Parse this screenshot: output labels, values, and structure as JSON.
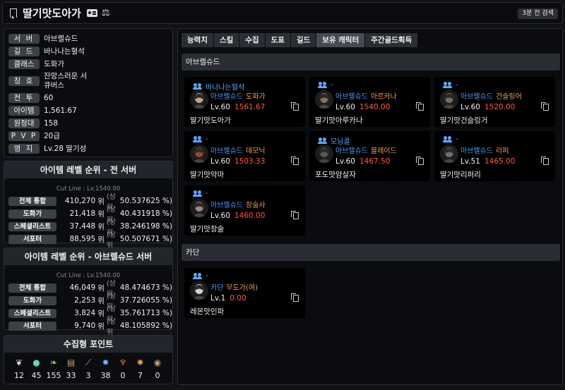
{
  "header": {
    "title": "딸기맛도아가",
    "scale_glyph": "⚖",
    "search_label": "3분 전 검색"
  },
  "info": [
    {
      "label": "서 버",
      "value": "아브렐슈드"
    },
    {
      "label": "길 드",
      "value": "바나나는혈석"
    },
    {
      "label": "클래스",
      "value": "도화가"
    },
    {
      "label": "칭 호",
      "value": "잔망스러운 서큐버스"
    },
    {
      "label": "전 투",
      "value": "60"
    },
    {
      "label": "아이템",
      "value": "1,561.67"
    },
    {
      "label": "원정대",
      "value": "158"
    },
    {
      "label": "P V P",
      "value": "20급"
    },
    {
      "label": "영 지",
      "value": "Lv.28 딸기성"
    }
  ],
  "rank_all": {
    "title": "아이템 레벨 순위 - 전 서버",
    "cutline": "Cut Line : Lv.1540.00",
    "rows": [
      {
        "label": "전체 통합",
        "rank": "410,270",
        "pct": "50.537625 %)"
      },
      {
        "label": "도화가",
        "rank": "21,418",
        "pct": "40.431918 %)"
      },
      {
        "label": "스페셜리스트",
        "rank": "37,448",
        "pct": "38.246198 %)"
      },
      {
        "label": "서포터",
        "rank": "88,595",
        "pct": "50.507671 %)"
      }
    ]
  },
  "rank_server": {
    "title": "아이템 레벨 순위 - 아브렐슈드 서버",
    "cutline": "Cut Line : Lv.1540.00",
    "rows": [
      {
        "label": "전체 통합",
        "rank": "46,049",
        "pct": "48.474673 %)"
      },
      {
        "label": "도화가",
        "rank": "2,253",
        "pct": "37.726055 %)"
      },
      {
        "label": "스페셜리스트",
        "rank": "3,824",
        "pct": "35.761713 %)"
      },
      {
        "label": "서포터",
        "rank": "9,740",
        "pct": "48.105892 %)"
      }
    ]
  },
  "rank_words": {
    "wi": "위",
    "sang": "(상위"
  },
  "collect": {
    "title": "수집형 포인트",
    "items": [
      {
        "icon": "mokoko-seed-icon",
        "glyph": "❦",
        "color": "#d8d8d8",
        "count": "12"
      },
      {
        "icon": "island-heart-icon",
        "glyph": "●",
        "color": "#5cd6c0",
        "count": "45"
      },
      {
        "icon": "sprout-icon",
        "glyph": "❧",
        "color": "#9ad14a",
        "count": "155"
      },
      {
        "icon": "masterpiece-icon",
        "glyph": "▤",
        "color": "#c9a46a",
        "count": "33"
      },
      {
        "icon": "voyage-icon",
        "glyph": "⟋",
        "color": "#e0b050",
        "count": "3"
      },
      {
        "icon": "giant-heart-icon",
        "glyph": "✸",
        "color": "#6fb3ff",
        "count": "38"
      },
      {
        "icon": "ignea-icon",
        "glyph": "♆",
        "color": "#c07040",
        "count": "0"
      },
      {
        "icon": "world-tree-leaf-icon",
        "glyph": "✹",
        "color": "#e0a040",
        "count": "7"
      },
      {
        "icon": "orpheus-star-icon",
        "glyph": "◉",
        "color": "#c8a070",
        "count": "0"
      }
    ]
  },
  "tabs": [
    "능력치",
    "스킬",
    "수집",
    "도표",
    "길드",
    "보유 캐릭터",
    "주간골드획득"
  ],
  "active_tab": 5,
  "servers": [
    {
      "name": "아브렐슈드",
      "chars": [
        {
          "guild": "바나나는혈석",
          "server": "아브렐슈드",
          "class": "도화가",
          "lv": "Lv.60",
          "ilvl": "1561.67",
          "name": "딸기맛도아가",
          "avatar": "#c8a38a"
        },
        {
          "guild": "-",
          "server": "아브렐슈드",
          "class": "아르카나",
          "lv": "Lv.60",
          "ilvl": "1540.00",
          "name": "딸기맛아루카나",
          "avatar": "#8a7060"
        },
        {
          "guild": "-",
          "server": "아브렐슈드",
          "class": "건슬링어",
          "lv": "Lv.60",
          "ilvl": "1520.00",
          "name": "딸기맛건슬링거",
          "avatar": "#7a6a60"
        },
        {
          "guild": "-",
          "server": "아브렐슈드",
          "class": "데모닉",
          "lv": "Lv.60",
          "ilvl": "1503.33",
          "name": "딸기맛악마",
          "avatar": "#a04030"
        },
        {
          "guild": "모닝콜",
          "server": "아브렐슈드",
          "class": "블레이드",
          "lv": "Lv.60",
          "ilvl": "1467.50",
          "name": "포도맛암살자",
          "avatar": "#605850"
        },
        {
          "guild": "-",
          "server": "아브렐슈드",
          "class": "리퍼",
          "lv": "Lv.51",
          "ilvl": "1465.00",
          "name": "딸기맛리퍼리",
          "avatar": "#707070"
        },
        {
          "guild": "-",
          "server": "아브렐슈드",
          "class": "창술사",
          "lv": "Lv.60",
          "ilvl": "1460.00",
          "name": "딸기맛창술",
          "avatar": "#9a8a80"
        }
      ]
    },
    {
      "name": "카단",
      "chars": [
        {
          "guild": "-",
          "server": "카단",
          "class": "무도가(여)",
          "lv": "Lv.1",
          "ilvl": "0.00",
          "name": "레몬맛인파",
          "avatar": "#d0d0d0"
        }
      ]
    }
  ]
}
